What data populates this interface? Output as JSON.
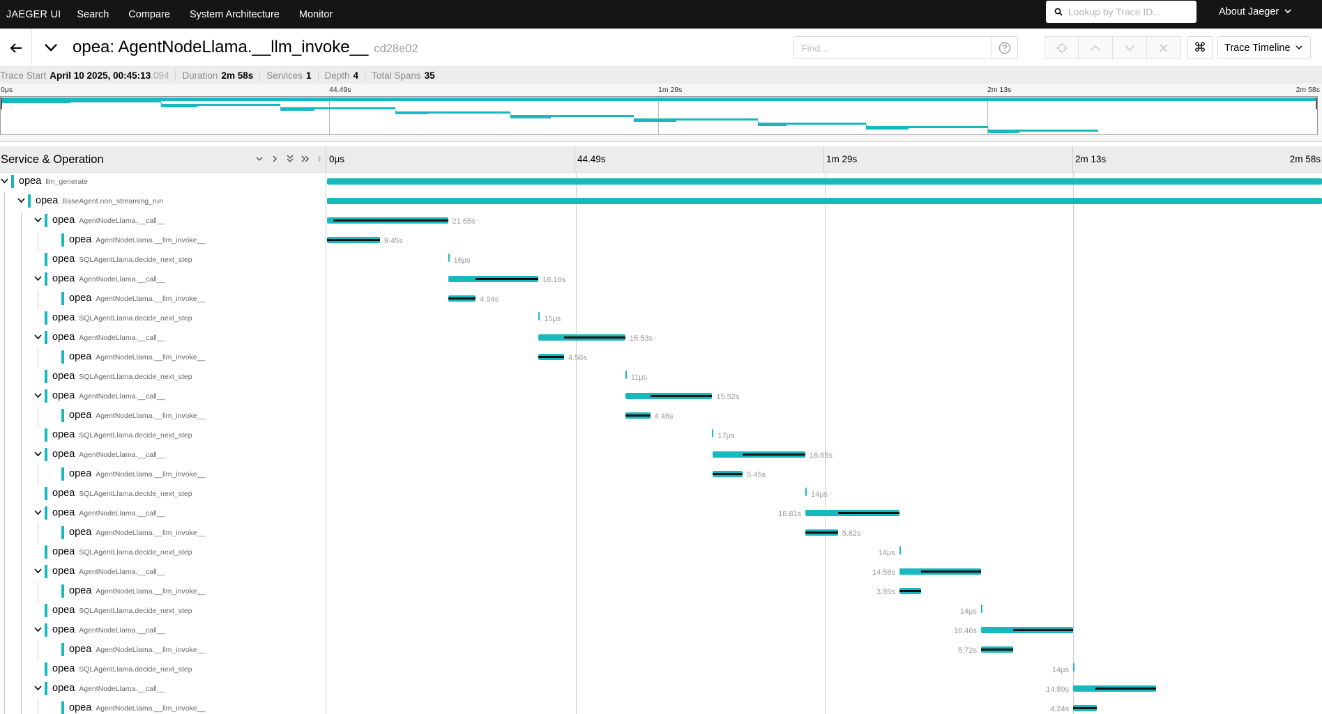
{
  "nav": {
    "brand": "JAEGER UI",
    "links": [
      "Search",
      "Compare",
      "System Architecture",
      "Monitor"
    ],
    "lookup_placeholder": "Lookup by Trace ID...",
    "about": "About Jaeger"
  },
  "trace": {
    "service": "opea",
    "operation": "AgentNodeLlama.__llm_invoke__",
    "title": "opea: AgentNodeLlama.__llm_invoke__",
    "id": "cd28e02",
    "find_placeholder": "Find...",
    "view": "Trace Timeline"
  },
  "summary": {
    "trace_start_label": "Trace Start",
    "trace_start": "April 10 2025, 00:45:13",
    "trace_start_ms": ".094",
    "duration_label": "Duration",
    "duration": "2m 58s",
    "services_label": "Services",
    "services": "1",
    "depth_label": "Depth",
    "depth": "4",
    "total_spans_label": "Total Spans",
    "total_spans": "35"
  },
  "timeline": {
    "header_title": "Service & Operation",
    "ticks": [
      "0μs",
      "44.49s",
      "1m 29s",
      "2m 13s",
      "2m 58s"
    ],
    "accent_color": "#17b8be",
    "spans": [
      {
        "depth": 0,
        "collapsible": true,
        "service": "opea",
        "operation": "llm_generate",
        "start": 0,
        "end": 1,
        "duration": ""
      },
      {
        "depth": 1,
        "collapsible": true,
        "service": "opea",
        "operation": "BaseAgent.non_streaming_run",
        "start": 0,
        "end": 1,
        "duration": ""
      },
      {
        "depth": 2,
        "collapsible": true,
        "service": "opea",
        "operation": "AgentNodeLlama.__call__",
        "start": 0,
        "end": 0.1216,
        "child": [
          0.053,
          1
        ],
        "duration": "21.65s"
      },
      {
        "depth": 3,
        "collapsible": false,
        "service": "opea",
        "operation": "AgentNodeLlama.__llm_invoke__",
        "start": 0,
        "end": 0.0531,
        "child": [
          0,
          1
        ],
        "duration": "9.45s"
      },
      {
        "depth": 2,
        "collapsible": false,
        "service": "opea",
        "operation": "SQLAgentLlama.decide_next_step",
        "start": 0.1216,
        "end": 0.1217,
        "duration": "16μs"
      },
      {
        "depth": 2,
        "collapsible": true,
        "service": "opea",
        "operation": "AgentNodeLlama.__call__",
        "start": 0.1217,
        "end": 0.2125,
        "child": [
          0.305,
          1
        ],
        "duration": "16.16s"
      },
      {
        "depth": 3,
        "collapsible": false,
        "service": "opea",
        "operation": "AgentNodeLlama.__llm_invoke__",
        "start": 0.1217,
        "end": 0.1495,
        "child": [
          0,
          1
        ],
        "duration": "4.94s"
      },
      {
        "depth": 2,
        "collapsible": false,
        "service": "opea",
        "operation": "SQLAgentLlama.decide_next_step",
        "start": 0.2125,
        "end": 0.2126,
        "duration": "15μs"
      },
      {
        "depth": 2,
        "collapsible": true,
        "service": "opea",
        "operation": "AgentNodeLlama.__call__",
        "start": 0.2126,
        "end": 0.2998,
        "child": [
          0.294,
          1
        ],
        "duration": "15.53s"
      },
      {
        "depth": 3,
        "collapsible": false,
        "service": "opea",
        "operation": "AgentNodeLlama.__llm_invoke__",
        "start": 0.2126,
        "end": 0.2382,
        "child": [
          0,
          1
        ],
        "duration": "4.56s"
      },
      {
        "depth": 2,
        "collapsible": false,
        "service": "opea",
        "operation": "SQLAgentLlama.decide_next_step",
        "start": 0.2998,
        "end": 0.2999,
        "duration": "11μs"
      },
      {
        "depth": 2,
        "collapsible": true,
        "service": "opea",
        "operation": "AgentNodeLlama.__call__",
        "start": 0.2999,
        "end": 0.3871,
        "child": [
          0.287,
          1
        ],
        "duration": "15.52s"
      },
      {
        "depth": 3,
        "collapsible": false,
        "service": "opea",
        "operation": "AgentNodeLlama.__llm_invoke__",
        "start": 0.2999,
        "end": 0.3249,
        "child": [
          0,
          1
        ],
        "duration": "4.46s"
      },
      {
        "depth": 2,
        "collapsible": false,
        "service": "opea",
        "operation": "SQLAgentLlama.decide_next_step",
        "start": 0.3871,
        "end": 0.3872,
        "duration": "17μs"
      },
      {
        "depth": 2,
        "collapsible": true,
        "service": "opea",
        "operation": "AgentNodeLlama.__call__",
        "start": 0.3872,
        "end": 0.4807,
        "child": [
          0.327,
          1
        ],
        "duration": "16.65s"
      },
      {
        "depth": 3,
        "collapsible": false,
        "service": "opea",
        "operation": "AgentNodeLlama.__llm_invoke__",
        "start": 0.3872,
        "end": 0.4178,
        "child": [
          0,
          1
        ],
        "duration": "5.45s"
      },
      {
        "depth": 2,
        "collapsible": false,
        "service": "opea",
        "operation": "SQLAgentLlama.decide_next_step",
        "start": 0.4807,
        "end": 0.4808,
        "duration": "14μs"
      },
      {
        "depth": 2,
        "collapsible": true,
        "service": "opea",
        "operation": "AgentNodeLlama.__call__",
        "start": 0.4808,
        "end": 0.5752,
        "child": [
          0.346,
          1
        ],
        "duration": "16.81s",
        "label_left": true
      },
      {
        "depth": 3,
        "collapsible": false,
        "service": "opea",
        "operation": "AgentNodeLlama.__llm_invoke__",
        "start": 0.4808,
        "end": 0.5135,
        "child": [
          0,
          1
        ],
        "duration": "5.82s"
      },
      {
        "depth": 2,
        "collapsible": false,
        "service": "opea",
        "operation": "SQLAgentLlama.decide_next_step",
        "start": 0.5752,
        "end": 0.5753,
        "duration": "14μs",
        "label_left": true
      },
      {
        "depth": 2,
        "collapsible": true,
        "service": "opea",
        "operation": "AgentNodeLlama.__call__",
        "start": 0.5753,
        "end": 0.6572,
        "child": [
          0.264,
          1
        ],
        "duration": "14.58s",
        "label_left": true
      },
      {
        "depth": 3,
        "collapsible": false,
        "service": "opea",
        "operation": "AgentNodeLlama.__llm_invoke__",
        "start": 0.5753,
        "end": 0.5969,
        "child": [
          0,
          1
        ],
        "duration": "3.85s",
        "label_left": true
      },
      {
        "depth": 2,
        "collapsible": false,
        "service": "opea",
        "operation": "SQLAgentLlama.decide_next_step",
        "start": 0.6572,
        "end": 0.6573,
        "duration": "14μs",
        "label_left": true
      },
      {
        "depth": 2,
        "collapsible": true,
        "service": "opea",
        "operation": "AgentNodeLlama.__call__",
        "start": 0.6573,
        "end": 0.7498,
        "child": [
          0.348,
          1
        ],
        "duration": "16.46s",
        "label_left": true
      },
      {
        "depth": 3,
        "collapsible": false,
        "service": "opea",
        "operation": "AgentNodeLlama.__llm_invoke__",
        "start": 0.6573,
        "end": 0.6894,
        "child": [
          0,
          1
        ],
        "duration": "5.72s",
        "label_left": true
      },
      {
        "depth": 2,
        "collapsible": false,
        "service": "opea",
        "operation": "SQLAgentLlama.decide_next_step",
        "start": 0.7498,
        "end": 0.7499,
        "duration": "14μs",
        "label_left": true
      },
      {
        "depth": 2,
        "collapsible": true,
        "service": "opea",
        "operation": "AgentNodeLlama.__call__",
        "start": 0.7499,
        "end": 0.8335,
        "child": [
          0.27,
          1
        ],
        "duration": "14.89s",
        "label_left": true
      },
      {
        "depth": 3,
        "collapsible": false,
        "service": "opea",
        "operation": "AgentNodeLlama.__llm_invoke__",
        "start": 0.7499,
        "end": 0.7737,
        "child": [
          0,
          1
        ],
        "duration": "4.24s",
        "label_left": true
      }
    ]
  }
}
